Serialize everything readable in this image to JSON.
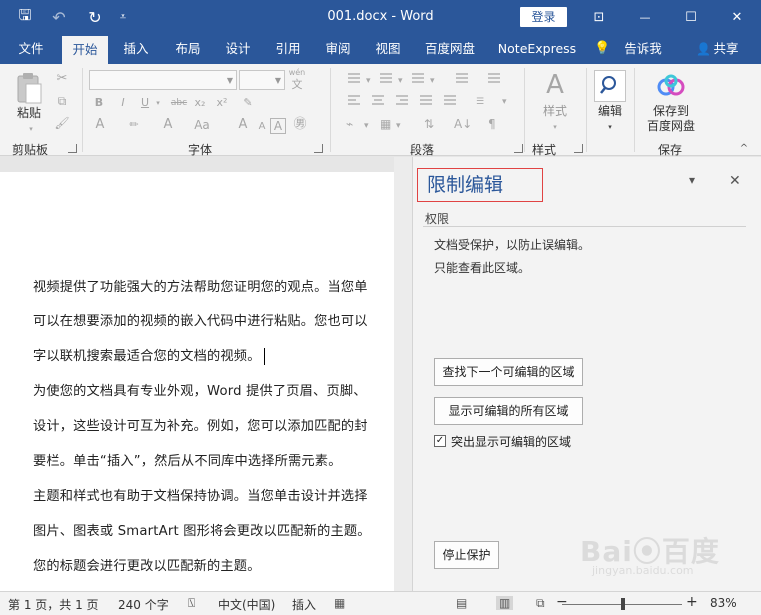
{
  "window": {
    "title": "001.docx  -  Word",
    "login_label": "登录",
    "quick_access": {
      "save_icon": "save-icon",
      "undo_icon": "undo-icon",
      "redo_icon": "redo-icon",
      "customize_icon": "customize-icon",
      "save_glyph": "🖫",
      "undo_glyph": "↶",
      "redo_glyph": "↻",
      "customize_glyph": "⩡"
    },
    "controls": {
      "ribbon_display_glyph": "⊡",
      "minimize_glyph": "—",
      "maximize_glyph": "☐",
      "close_glyph": "✕"
    }
  },
  "tabs": {
    "file": "文件",
    "home": "开始",
    "insert": "插入",
    "layout": "布局",
    "design": "设计",
    "references": "引用",
    "review": "审阅",
    "view": "视图",
    "baidu": "百度网盘",
    "noteexpress": "NoteExpress",
    "tellme": "告诉我",
    "share": "共享",
    "tellme_glyph": "💡",
    "share_glyph": "👤"
  },
  "ribbon": {
    "clipboard": {
      "group_label": "剪贴板",
      "paste_label": "粘贴"
    },
    "font": {
      "group_label": "字体",
      "glyphs": {
        "wen": "wén",
        "bold": "B",
        "italic": "I",
        "underline": "U",
        "strike": "abc",
        "sub": "x₂",
        "sup": "x²",
        "clear": "✎",
        "texteffect": "A",
        "highlight": "✏",
        "fontcolor": "A",
        "changecase": "Aa",
        "grow": "A",
        "shrink": "A",
        "phonetic": "A",
        "circled": "㊚"
      }
    },
    "paragraph": {
      "group_label": "段落"
    },
    "styles": {
      "group_label": "样式",
      "styles_label": "样式"
    },
    "editing": {
      "edit_label": "编辑"
    },
    "save": {
      "group_label": "保存",
      "save_to_label_1": "保存到",
      "save_to_label_2": "百度网盘"
    },
    "collapse_glyph": "^"
  },
  "document": {
    "lines": [
      "视频提供了功能强大的方法帮助您证明您的观点。当您单",
      "可以在想要添加的视频的嵌入代码中进行粘贴。您也可以",
      "字以联机搜索最适合您的文档的视频。",
      "为使您的文档具有专业外观，Word 提供了页眉、页脚、",
      "设计，这些设计可互为补充。例如，您可以添加匹配的封",
      "要栏。单击“插入”，然后从不同库中选择所需元素。",
      "主题和样式也有助于文档保持协调。当您单击设计并选择",
      "图片、图表或 SmartArt 图形将会更改以匹配新的主题。",
      "您的标题会进行更改以匹配新的主题。"
    ]
  },
  "pane": {
    "title": "限制编辑",
    "dropdown_glyph": "▾",
    "close_glyph": "✕",
    "section": "权限",
    "line1": "文档受保护，以防止误编辑。",
    "line2": "只能查看此区域。",
    "find_next_btn": "查找下一个可编辑的区域",
    "show_all_btn": "显示可编辑的所有区域",
    "highlight_label": "突出显示可编辑的区域",
    "highlight_checked": "✓",
    "stop_btn": "停止保护"
  },
  "watermark": {
    "main": "Bai⦿百度",
    "sub": "jingyan.baidu.com"
  },
  "status": {
    "page": "第 1 页，共 1 页",
    "words": "240 个字",
    "proof_glyph": "⍂",
    "language": "中文(中国)",
    "mode": "插入",
    "macro_glyph": "▦",
    "read_mode_glyph": "▤",
    "print_layout_glyph": "▥",
    "web_layout_glyph": "⧉",
    "zoom_out": "−",
    "zoom_in": "+",
    "zoom": "83%"
  }
}
